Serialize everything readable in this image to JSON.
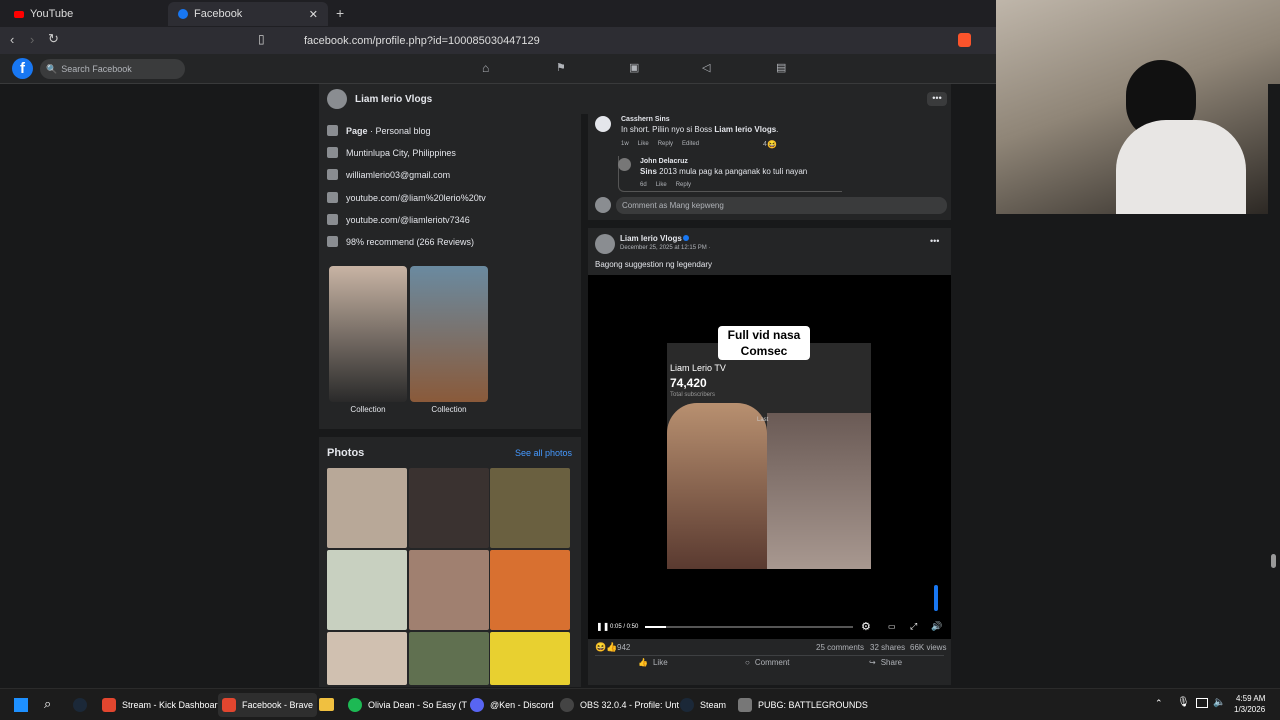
{
  "browser": {
    "tabs": [
      {
        "label": "YouTube",
        "color": "#ff0000"
      },
      {
        "label": "Facebook",
        "color": "#1877f2"
      }
    ],
    "url": "facebook.com/profile.php?id=100085030447129"
  },
  "fb": {
    "search_placeholder": "Search Facebook",
    "profile_name": "Liam Ierio Vlogs",
    "intro": {
      "page_label": "Page",
      "page_type": " · Personal blog",
      "location": "Muntinlupa City, Philippines",
      "email": "williamlerio03@gmail.com",
      "link1": "youtube.com/@liam%20lerio%20tv",
      "link2": "youtube.com/@liamleriotv7346",
      "recommend": "98% recommend (266 Reviews)"
    },
    "collections": [
      {
        "label": "Collection"
      },
      {
        "label": "Collection"
      }
    ],
    "photos": {
      "title": "Photos",
      "see_all": "See all photos"
    },
    "comments": [
      {
        "author": "Casshern Sins",
        "text_pre": "In short. Piliin nyo si Boss ",
        "text_bold": "Liam Ierio Vlogs",
        "text_post": ".",
        "meta": [
          "1w",
          "Like",
          "Reply",
          "Edited"
        ],
        "react_count": "4"
      },
      {
        "author": "John Delacruz",
        "mention": "Sins",
        "text": " 2013 mula pag ka panganak ko tuli nayan",
        "meta": [
          "6d",
          "Like",
          "Reply"
        ]
      }
    ],
    "comment_placeholder": "Comment as Mang kepweng",
    "post": {
      "author": "Liam Ierio Vlogs",
      "date": "December 25, 2025 at 12:15 PM · ",
      "text": "Bagong suggestion ng legendary",
      "overlay_caption_1": "Full vid nasa",
      "overlay_caption_2": "Comsec",
      "yt_channel": "Liam Lerio TV",
      "yt_subs": "74,420",
      "yt_subs_label": "Total subscribers",
      "last_label": "Last",
      "time": "0:05 / 0:50",
      "progress": 0.1,
      "reactions": "942",
      "comments": "25 comments",
      "shares": "32 shares",
      "views": "66K views",
      "actions": [
        "Like",
        "Comment",
        "Share"
      ]
    }
  },
  "taskbar": {
    "apps": [
      {
        "label": "Stream - Kick Dashboar",
        "color": "#e2462f"
      },
      {
        "label": "Facebook - Brave",
        "color": "#e2462f"
      },
      {
        "label": "Olivia Dean - So Easy (T",
        "color": "#1db954"
      },
      {
        "label": "@Ken - Discord",
        "color": "#5865f2"
      },
      {
        "label": "OBS 32.0.4 - Profile: Unt",
        "color": "#444444"
      },
      {
        "label": "Steam",
        "color": "#1b2838"
      },
      {
        "label": "PUBG: BATTLEGROUNDS",
        "color": "#777777"
      }
    ],
    "time": "4:59 AM",
    "date": "1/3/2026"
  }
}
